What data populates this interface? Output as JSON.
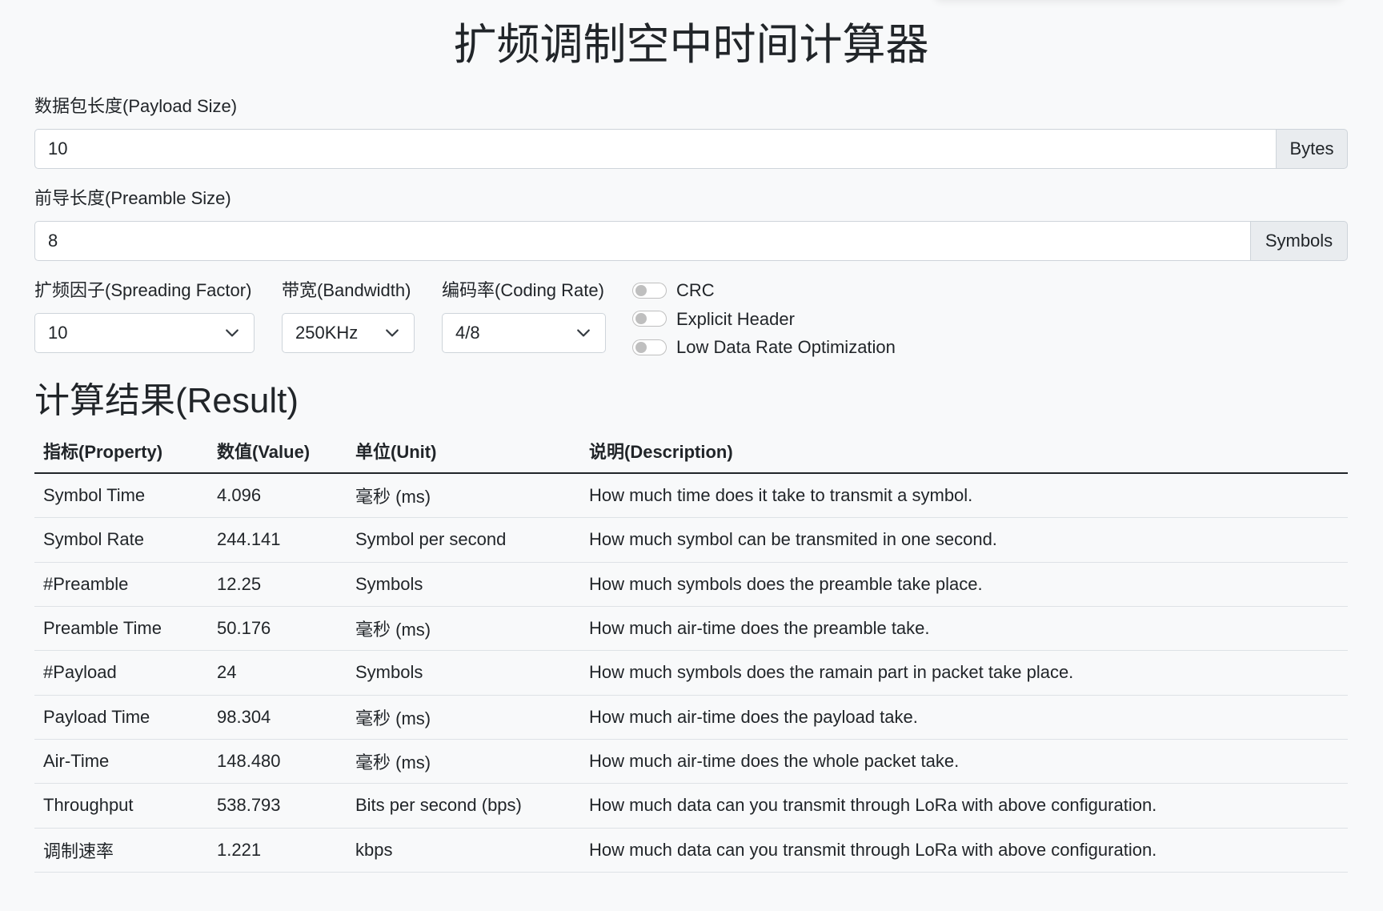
{
  "app": {
    "title": "扩频调制空中时间计算器"
  },
  "form": {
    "payload_size": {
      "label": "数据包长度(Payload Size)",
      "value": "10",
      "unit": "Bytes"
    },
    "preamble_size": {
      "label": "前导长度(Preamble Size)",
      "value": "8",
      "unit": "Symbols"
    },
    "spreading_factor": {
      "label": "扩频因子(Spreading Factor)",
      "selected": "10"
    },
    "bandwidth": {
      "label": "带宽(Bandwidth)",
      "selected": "250KHz"
    },
    "coding_rate": {
      "label": "编码率(Coding Rate)",
      "selected": "4/8"
    },
    "switches": [
      {
        "label": "CRC",
        "checked": false
      },
      {
        "label": "Explicit Header",
        "checked": false
      },
      {
        "label": "Low Data Rate Optimization",
        "checked": false
      }
    ]
  },
  "result": {
    "heading": "计算结果(Result)",
    "columns": [
      "指标(Property)",
      "数值(Value)",
      "单位(Unit)",
      "说明(Description)"
    ],
    "rows": [
      {
        "property": "Symbol Time",
        "value": "4.096",
        "unit": "毫秒 (ms)",
        "description": "How much time does it take to transmit a symbol."
      },
      {
        "property": "Symbol Rate",
        "value": "244.141",
        "unit": "Symbol per second",
        "description": "How much symbol can be transmited in one second."
      },
      {
        "property": "#Preamble",
        "value": "12.25",
        "unit": "Symbols",
        "description": "How much symbols does the preamble take place."
      },
      {
        "property": "Preamble Time",
        "value": "50.176",
        "unit": "毫秒 (ms)",
        "description": "How much air-time does the preamble take."
      },
      {
        "property": "#Payload",
        "value": "24",
        "unit": "Symbols",
        "description": "How much symbols does the ramain part in packet take place."
      },
      {
        "property": "Payload Time",
        "value": "98.304",
        "unit": "毫秒 (ms)",
        "description": "How much air-time does the payload take."
      },
      {
        "property": "Air-Time",
        "value": "148.480",
        "unit": "毫秒 (ms)",
        "description": "How much air-time does the whole packet take."
      },
      {
        "property": "Throughput",
        "value": "538.793",
        "unit": "Bits per second (bps)",
        "description": "How much data can you transmit through LoRa with above configuration."
      },
      {
        "property": "调制速率",
        "value": "1.221",
        "unit": "kbps",
        "description": "How much data can you transmit through LoRa with above configuration."
      }
    ]
  },
  "icons": {
    "select_caret": "chevron-down-icon"
  },
  "colors": {
    "page_background": "#f8f9fa",
    "text": "#212529",
    "input_border": "#ced4da",
    "input_addon_background": "#e9ecef",
    "row_divider": "#dee2e6"
  }
}
